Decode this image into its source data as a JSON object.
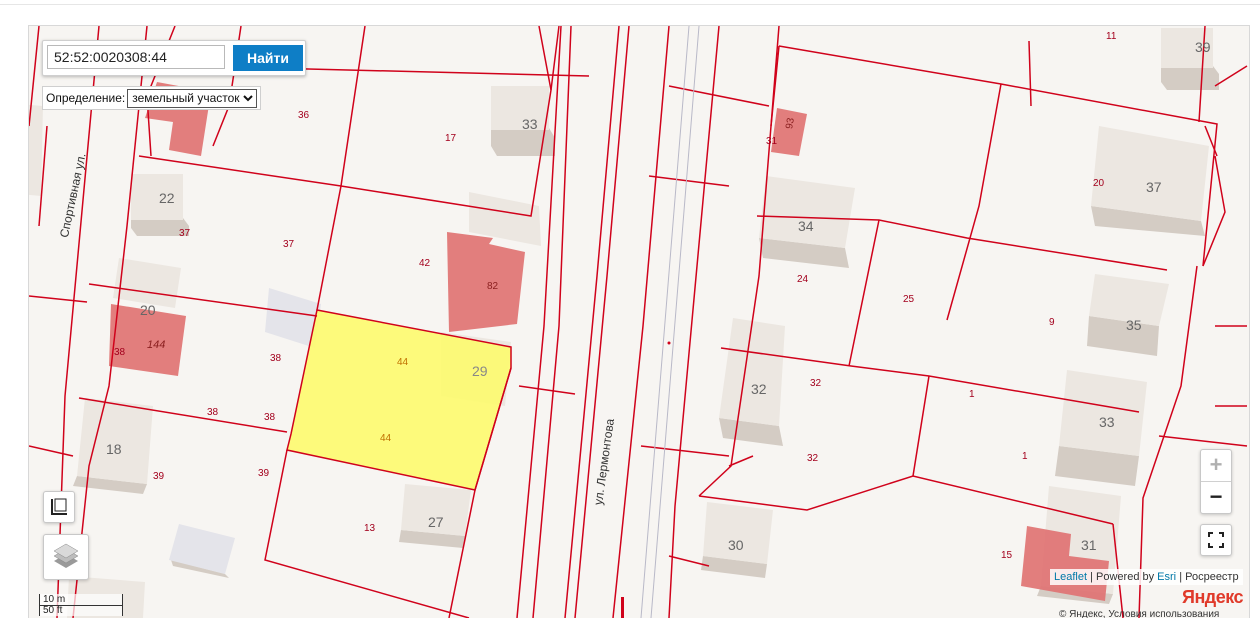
{
  "search": {
    "value": "52:52:0020308:44",
    "button_label": "Найти"
  },
  "definition": {
    "label": "Определение:",
    "selected": "земельный участок"
  },
  "streets": [
    {
      "name": "Спортивная ул."
    },
    {
      "name": "ул. Лермонтова"
    }
  ],
  "parcel_numbers": [
    "11",
    "36",
    "17",
    "37",
    "37",
    "42",
    "38",
    "38",
    "38",
    "38",
    "44",
    "44",
    "39",
    "39",
    "13",
    "20",
    "24",
    "25",
    "9",
    "32",
    "32",
    "1",
    "1",
    "15",
    "31"
  ],
  "building_numbers": [
    "39",
    "33",
    "22",
    "37",
    "34",
    "82",
    "93",
    "20",
    "144",
    "29",
    "35",
    "32",
    "18",
    "33",
    "27",
    "30",
    "31"
  ],
  "controls": {
    "zoom_in": "+",
    "zoom_out": "−",
    "scale_metric": "10 m",
    "scale_imperial": "50 ft"
  },
  "attribution": {
    "leaflet": "Leaflet",
    "powered_by": "Powered by",
    "esri": "Esri",
    "rosreestr": "Росреестр",
    "yandex": "Яндекс",
    "copyright": "© Яндекс, Условия использования"
  },
  "colors": {
    "parcel_border": "#d0021b",
    "selected_fill": "#fdfb6e",
    "highlighted_building": "#e07373",
    "building_top": "#ece7e1",
    "search_button": "#0e7ec6"
  }
}
